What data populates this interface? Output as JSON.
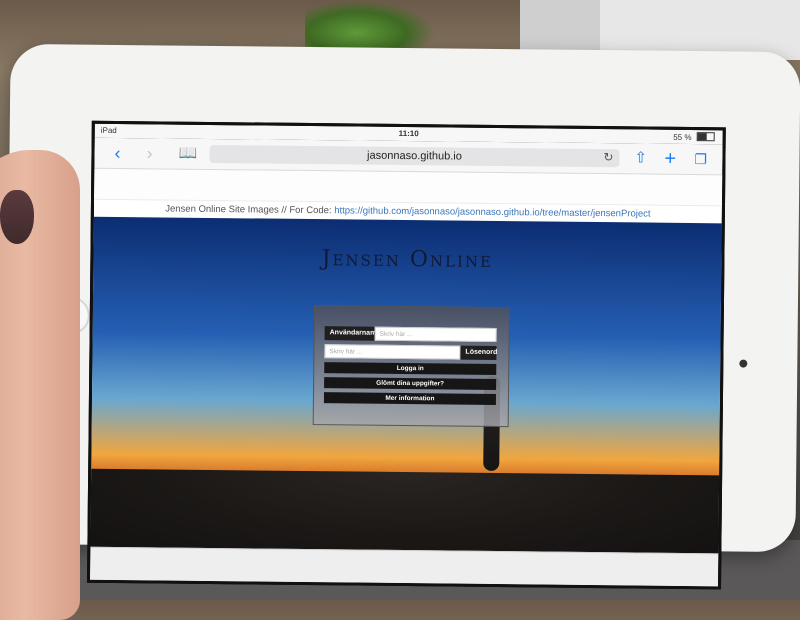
{
  "status": {
    "device": "iPad",
    "time": "11:10",
    "battery": "55 %",
    "battery_level": 0.55
  },
  "toolbar": {
    "url": "jasonnaso.github.io",
    "back_icon": "chevron-left-icon",
    "forward_icon": "chevron-right-icon",
    "bookmarks_icon": "book-icon",
    "share_icon": "share-icon",
    "new_tab_icon": "plus-icon",
    "tabs_icon": "tabs-icon",
    "reload_icon": "reload-icon"
  },
  "page": {
    "header_text": "Jensen Online Site Images // For Code: ",
    "header_link": "https://github.com/jasonnaso/jasonnaso.github.io/tree/master/jensenProject",
    "title": "Jensen Online",
    "login": {
      "username_label": "Användarnamn",
      "username_placeholder": "Skriv här ...",
      "password_label": "Lösenord",
      "password_placeholder": "Skriv här ...",
      "login_button": "Logga in",
      "forgot_button": "Glömt dina uppgifter?",
      "info_button": "Mer information"
    }
  }
}
